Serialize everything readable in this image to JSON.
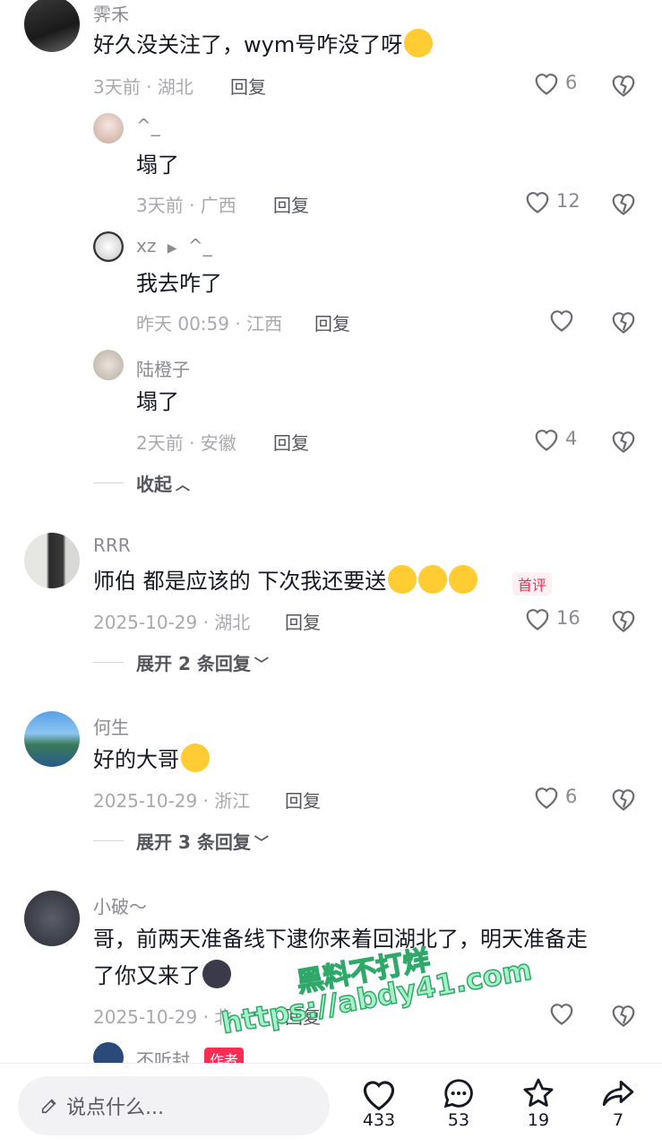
{
  "comments": [
    {
      "user": "霁禾",
      "text": "好久没关注了，wym号咋没了呀",
      "meta": "3天前 · 湖北",
      "reply": "回复",
      "likes": "6"
    },
    {
      "user": "^_",
      "text": "塌了",
      "meta": "3天前 · 广西",
      "reply": "回复",
      "likes": "12"
    },
    {
      "user": "xz",
      "reply_to": "^_",
      "text": "我去咋了",
      "meta": "昨天 00:59 · 江西",
      "reply": "回复",
      "likes": ""
    },
    {
      "user": "陆橙子",
      "text": "塌了",
      "meta": "2天前 · 安徽",
      "reply": "回复",
      "likes": "4"
    },
    {
      "user": "RRR",
      "text": "师伯 都是应该的 下次我还要送",
      "tag": "首评",
      "meta": "2025-10-29 · 湖北",
      "reply": "回复",
      "likes": "16"
    },
    {
      "user": "何生",
      "text": "好的大哥",
      "meta": "2025-10-29 · 浙江",
      "reply": "回复",
      "likes": "6"
    },
    {
      "user": "小破～",
      "text_line1": "哥，前两天准备线下逮你来着回湖北了，明天准备走",
      "text_line2": "了你又来了",
      "meta": "2025-10-29 · 北",
      "reply": "回复",
      "likes": ""
    },
    {
      "user": "不听封",
      "tag": "作者"
    }
  ],
  "collapse_label": "收起",
  "expand1": "展开 2 条回复",
  "expand2": "展开 3 条回复",
  "input_placeholder": "说点什么...",
  "actions": {
    "like": "433",
    "comment": "53",
    "favorite": "19",
    "share": "7"
  },
  "watermark": {
    "line1": "黑料不打烊",
    "line2": "https://abdy41.com"
  }
}
